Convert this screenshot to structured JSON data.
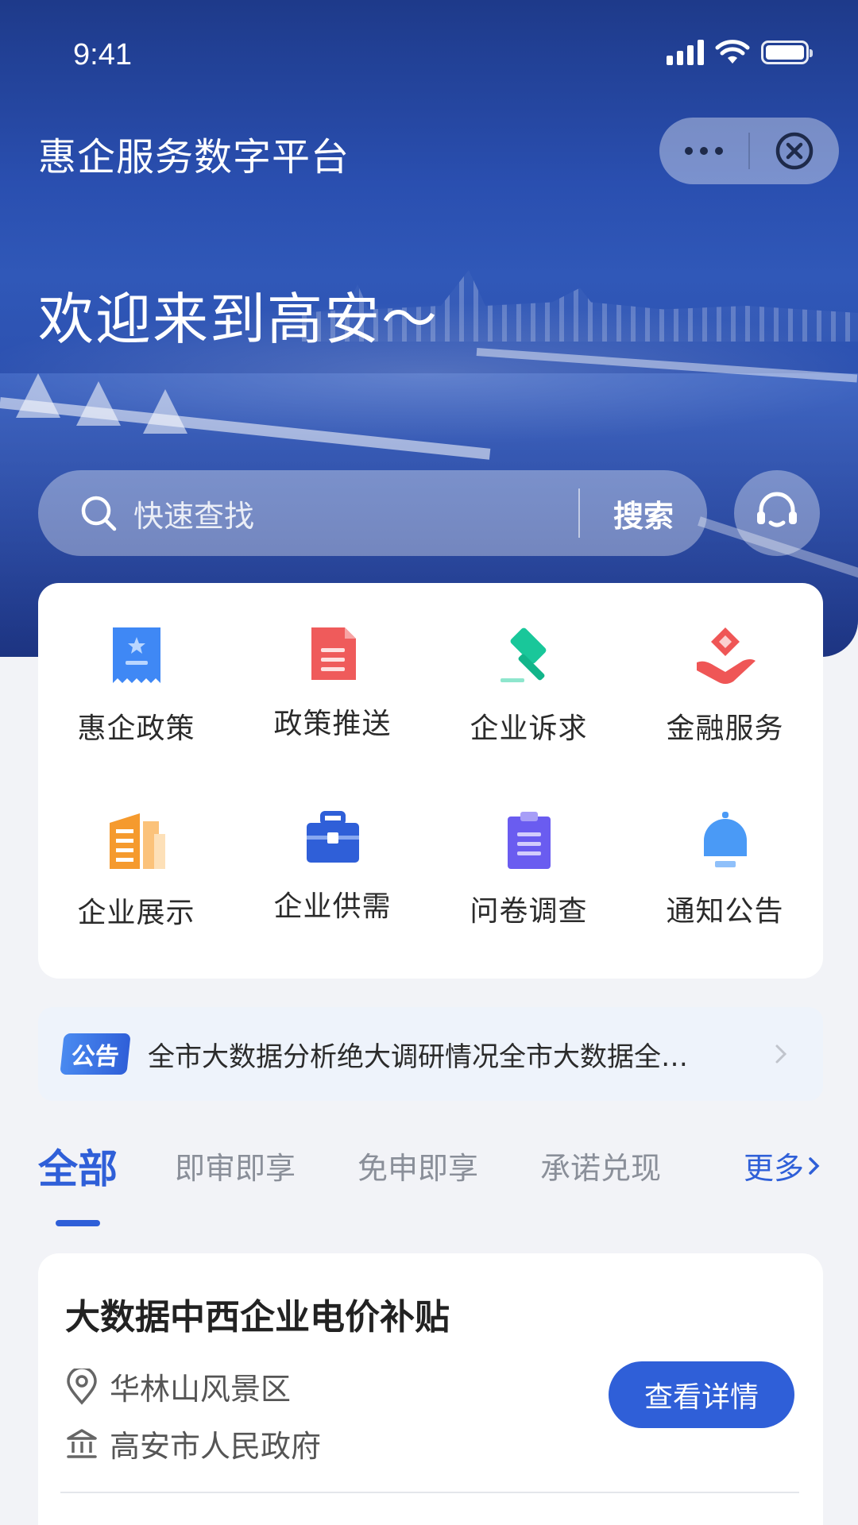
{
  "status_bar": {
    "time": "9:41"
  },
  "header": {
    "title": "惠企服务数字平台",
    "welcome": "欢迎来到高安～"
  },
  "search": {
    "placeholder": "快速查找",
    "button": "搜索"
  },
  "grid": [
    {
      "label": "惠企政策",
      "icon": "policy-bookmark-icon",
      "color": "#3f88f5"
    },
    {
      "label": "政策推送",
      "icon": "document-icon",
      "color": "#ef5b5b"
    },
    {
      "label": "企业诉求",
      "icon": "gavel-icon",
      "color": "#19c79a"
    },
    {
      "label": "金融服务",
      "icon": "hand-diamond-icon",
      "color": "#ef5656"
    },
    {
      "label": "企业展示",
      "icon": "buildings-icon",
      "color": "#f59a2e"
    },
    {
      "label": "企业供需",
      "icon": "briefcase-icon",
      "color": "#2f5fd8"
    },
    {
      "label": "问卷调查",
      "icon": "clipboard-icon",
      "color": "#6a5cf0"
    },
    {
      "label": "通知公告",
      "icon": "bell-icon",
      "color": "#4a9af6"
    }
  ],
  "notice": {
    "badge": "公告",
    "text": "全市大数据分析绝大调研情况全市大数据全…"
  },
  "tabs": {
    "items": [
      "全部",
      "即审即享",
      "免申即享",
      "承诺兑现"
    ],
    "more": "更多"
  },
  "card": {
    "title": "大数据中西企业电价补贴",
    "location": "华林山风景区",
    "org": "高安市人民政府",
    "button": "查看详情"
  },
  "colors": {
    "accent": "#2f5fd8",
    "background": "#f2f3f7"
  }
}
